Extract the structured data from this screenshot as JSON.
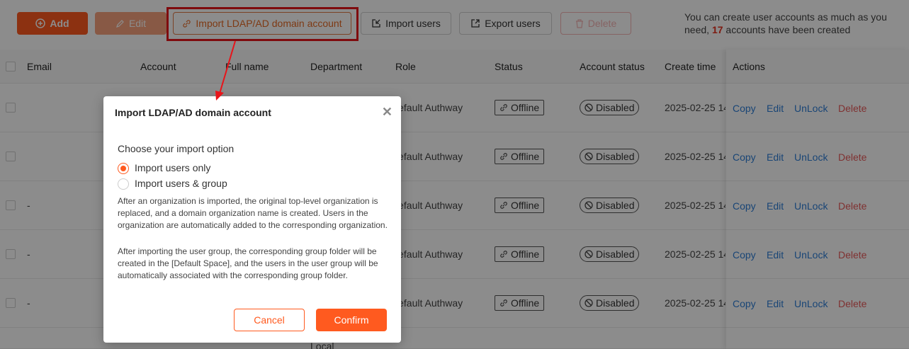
{
  "toolbar": {
    "add_label": "Add",
    "edit_label": "Edit",
    "ldap_label": "Import LDAP/AD domain account",
    "import_label": "Import users",
    "export_label": "Export users",
    "delete_label": "Delete"
  },
  "info": {
    "prefix": "You can create user accounts as much as you need,",
    "count": "17",
    "suffix": "accounts have been created"
  },
  "table": {
    "headers": {
      "email": "Email",
      "account": "Account",
      "full_name": "Full name",
      "department": "Department",
      "role": "Role",
      "status": "Status",
      "account_status": "Account status",
      "create_time": "Create time",
      "actions": "Actions"
    },
    "rows": [
      {
        "email": "",
        "role": "Default Authway",
        "status": "Offline",
        "account_status": "Disabled",
        "create_time": "2025-02-25 14",
        "copy": "Copy",
        "edit": "Edit",
        "unlock": "UnLock",
        "delete": "Delete"
      },
      {
        "email": "",
        "role": "Default Authway",
        "status": "Offline",
        "account_status": "Disabled",
        "create_time": "2025-02-25 14",
        "copy": "Copy",
        "edit": "Edit",
        "unlock": "UnLock",
        "delete": "Delete"
      },
      {
        "email": "-",
        "role": "Default Authway",
        "status": "Offline",
        "account_status": "Disabled",
        "create_time": "2025-02-25 14",
        "copy": "Copy",
        "edit": "Edit",
        "unlock": "UnLock",
        "delete": "Delete"
      },
      {
        "email": "-",
        "role": "Default Authway",
        "status": "Offline",
        "account_status": "Disabled",
        "create_time": "2025-02-25 14",
        "copy": "Copy",
        "edit": "Edit",
        "unlock": "UnLock",
        "delete": "Delete"
      },
      {
        "email": "-",
        "role": "Default Authway",
        "status": "Offline",
        "account_status": "Disabled",
        "create_time": "2025-02-25 14",
        "copy": "Copy",
        "edit": "Edit",
        "unlock": "UnLock",
        "delete": "Delete"
      }
    ],
    "partial_row": {
      "department": "Local"
    }
  },
  "dialog": {
    "title": "Import LDAP/AD domain account",
    "option_label": "Choose your import option",
    "options": [
      {
        "label": "Import users only",
        "selected": true
      },
      {
        "label": "Import users & group",
        "selected": false
      }
    ],
    "desc1": "After an organization is imported, the original top-level organization is replaced, and a domain organization name is created. Users in the organization are automatically added to the corresponding organization.",
    "desc2": "After importing the user group, the corresponding group folder will be created in the [Default Space], and the users in the user group will be automatically associated with the corresponding group folder.",
    "cancel_label": "Cancel",
    "confirm_label": "Confirm"
  },
  "colors": {
    "accent": "#ff5a1f",
    "highlight": "#e8141a",
    "link": "#2f7fd8",
    "danger": "#e85a5a"
  },
  "icons": [
    "plus-circle-icon",
    "pencil-icon",
    "link-icon",
    "import-icon",
    "export-icon",
    "trash-icon",
    "chain-link-icon",
    "ban-icon",
    "close-icon"
  ]
}
